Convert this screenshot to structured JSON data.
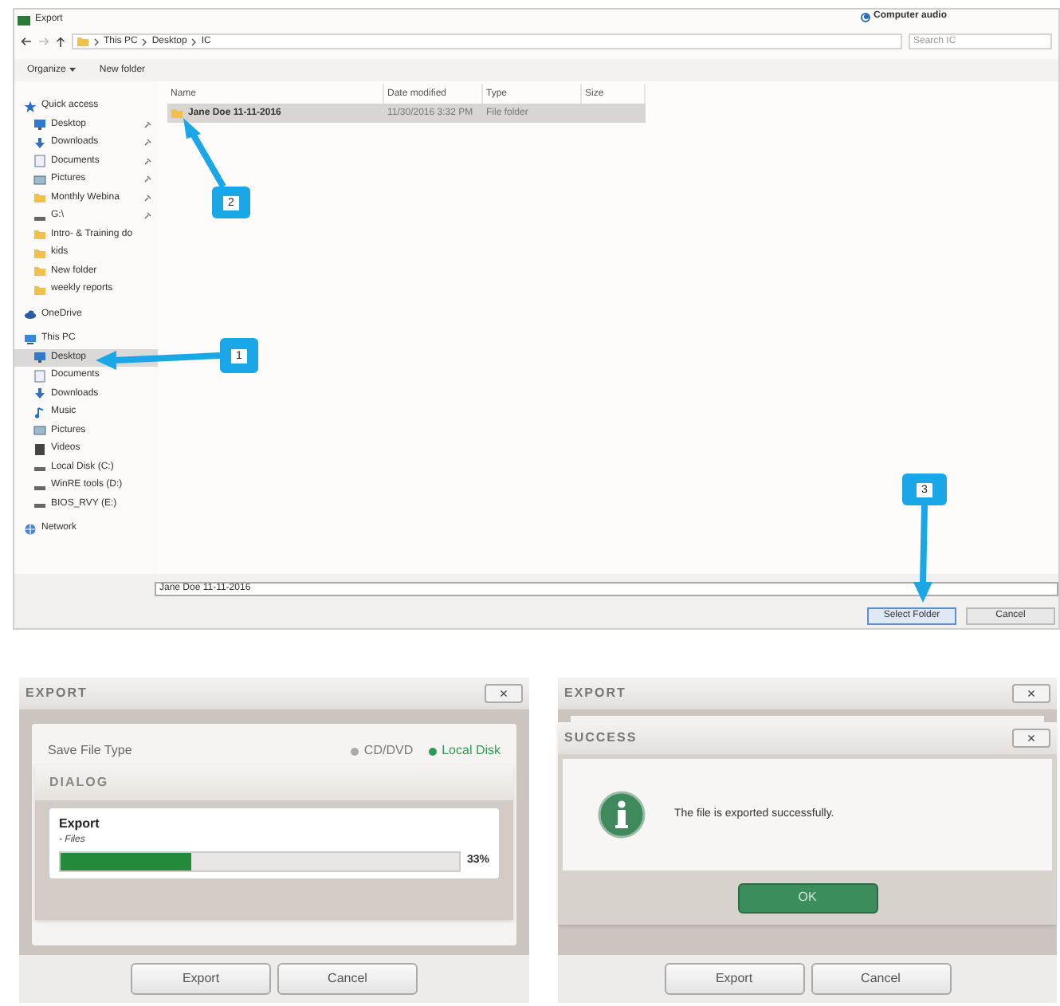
{
  "file_dialog": {
    "title": "Export",
    "audio_options": [
      {
        "label": "Computer audio",
        "selected": true
      }
    ],
    "breadcrumb": [
      "This PC",
      "Desktop",
      "IC"
    ],
    "search": {
      "placeholder": "Search IC"
    },
    "toolbar": [
      "Organize",
      "New folder"
    ],
    "nav_tree": [
      {
        "label": "Quick access",
        "kind": "star",
        "selected": false,
        "children": [
          {
            "label": "Desktop",
            "kind": "desktop",
            "pinned": true,
            "selected": false
          },
          {
            "label": "Downloads",
            "kind": "download",
            "pinned": true,
            "selected": false
          },
          {
            "label": "Documents",
            "kind": "document",
            "pinned": true,
            "selected": false
          },
          {
            "label": "Pictures",
            "kind": "picture",
            "pinned": true,
            "selected": false
          },
          {
            "label": "Monthly Webina",
            "kind": "folder",
            "pinned": true,
            "selected": false
          },
          {
            "label": "G:\\",
            "kind": "drive",
            "pinned": true,
            "selected": false
          },
          {
            "label": "Intro- & Training do",
            "kind": "folder",
            "pinned": false,
            "selected": false
          },
          {
            "label": "kids",
            "kind": "folder",
            "pinned": false,
            "selected": false
          },
          {
            "label": "New folder",
            "kind": "folder",
            "pinned": false,
            "selected": false
          },
          {
            "label": "weekly reports",
            "kind": "folder",
            "pinned": false,
            "selected": false
          }
        ]
      },
      {
        "label": "OneDrive",
        "kind": "cloud",
        "selected": false
      },
      {
        "label": "This PC",
        "kind": "pc",
        "selected": false,
        "children": [
          {
            "label": "Desktop",
            "kind": "desktop",
            "pinned": false,
            "selected": true
          },
          {
            "label": "Documents",
            "kind": "document",
            "pinned": false,
            "selected": false
          },
          {
            "label": "Downloads",
            "kind": "download",
            "pinned": false,
            "selected": false
          },
          {
            "label": "Music",
            "kind": "music",
            "pinned": false,
            "selected": false
          },
          {
            "label": "Pictures",
            "kind": "picture",
            "pinned": false,
            "selected": false
          },
          {
            "label": "Videos",
            "kind": "video",
            "pinned": false,
            "selected": false
          },
          {
            "label": "Local Disk (C:)",
            "kind": "drive",
            "pinned": false,
            "selected": false
          },
          {
            "label": "WinRE tools (D:)",
            "kind": "drive",
            "pinned": false,
            "selected": false
          },
          {
            "label": "BIOS_RVY (E:)",
            "kind": "drive",
            "pinned": false,
            "selected": false
          }
        ]
      },
      {
        "label": "Network",
        "kind": "network",
        "selected": false
      }
    ],
    "columns": [
      "Name",
      "Date modified",
      "Type",
      "Size"
    ],
    "rows": [
      {
        "name": "Jane Doe 11-11-2016",
        "date_modified": "11/30/2016 3:32 PM",
        "type": "File folder",
        "selected": true
      }
    ],
    "filename": "Jane Doe 11-11-2016",
    "buttons": [
      {
        "label": "Select Folder",
        "kind": "primary"
      },
      {
        "label": "Cancel",
        "kind": "normal"
      }
    ],
    "callouts": [
      "2",
      "1",
      "3"
    ]
  },
  "export_progress": {
    "title": "EXPORT",
    "close": "×",
    "save_type_label": "Save File Type",
    "save_types": [
      {
        "label": "CD/DVD",
        "selected": false
      },
      {
        "label": "Local Disk",
        "selected": true
      }
    ],
    "dialog_title": "DIALOG",
    "task": "Export",
    "subtask": "- Files",
    "level": 0.33,
    "reading": "33%",
    "buttons": [
      "Export",
      "Cancel"
    ]
  },
  "export_success": {
    "title": "EXPORT",
    "close": "×",
    "success_title": "SUCCESS",
    "success_close": "×",
    "message": "The file is exported successfully.",
    "ok": "OK",
    "buttons": [
      "Export",
      "Cancel"
    ]
  }
}
